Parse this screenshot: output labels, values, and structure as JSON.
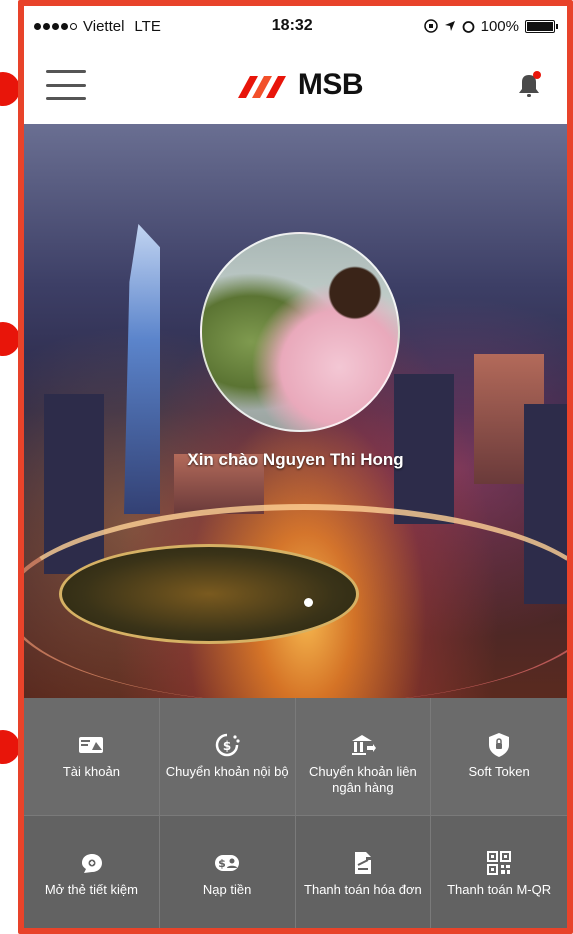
{
  "status_bar": {
    "carrier": "Viettel",
    "network": "LTE",
    "time": "18:32",
    "battery": "100%"
  },
  "header": {
    "logo_text": "MSB",
    "menu_icon": "hamburger-icon",
    "notification_icon": "bell-icon",
    "notification_badge_color": "#e8150a"
  },
  "hero": {
    "greeting": "Xin chào Nguyen Thi Hong"
  },
  "grid": {
    "items": [
      {
        "label": "Tài khoản",
        "icon": "card-icon"
      },
      {
        "label": "Chuyển khoản nội bộ",
        "icon": "dollar-refresh-icon"
      },
      {
        "label": "Chuyển khoản liên ngân hàng",
        "icon": "bank-transfer-icon"
      },
      {
        "label": "Soft Token",
        "icon": "shield-icon"
      },
      {
        "label": "Mở thẻ tiết kiệm",
        "icon": "piggy-bank-icon"
      },
      {
        "label": "Nạp tiền",
        "icon": "topup-icon"
      },
      {
        "label": "Thanh toán hóa đơn",
        "icon": "bill-icon"
      },
      {
        "label": "Thanh toán M-QR",
        "icon": "qr-code-icon"
      }
    ]
  },
  "colors": {
    "frame": "#e8432a",
    "brand_red": "#e8150a",
    "grid_bg": "#6b6b6b"
  }
}
